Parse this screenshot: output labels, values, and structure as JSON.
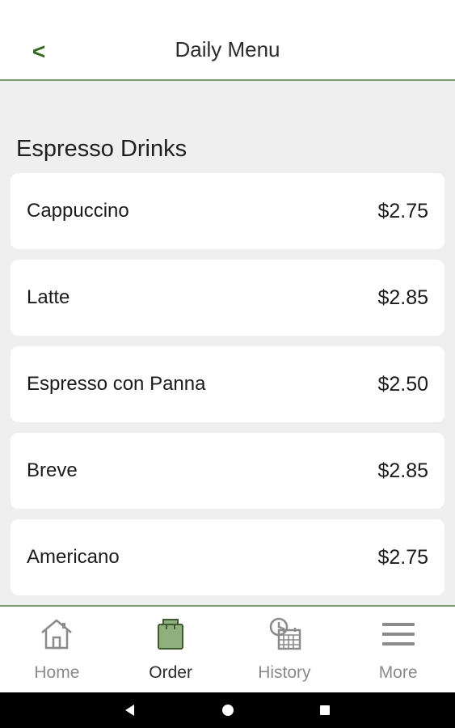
{
  "header": {
    "back_label": "<",
    "title": "Daily Menu"
  },
  "section": {
    "title": "Espresso Drinks"
  },
  "menu_items": [
    {
      "name": "Cappuccino",
      "price": "$2.75"
    },
    {
      "name": "Latte",
      "price": "$2.85"
    },
    {
      "name": "Espresso con Panna",
      "price": "$2.50"
    },
    {
      "name": "Breve",
      "price": "$2.85"
    },
    {
      "name": "Americano",
      "price": "$2.75"
    }
  ],
  "bottom_nav": {
    "items": [
      {
        "label": "Home",
        "icon": "home-icon",
        "active": false
      },
      {
        "label": "Order",
        "icon": "shopping-bag-icon",
        "active": true
      },
      {
        "label": "History",
        "icon": "history-calendar-icon",
        "active": false
      },
      {
        "label": "More",
        "icon": "menu-icon",
        "active": false
      }
    ]
  },
  "system_nav": {
    "buttons": [
      {
        "icon": "back-triangle-icon"
      },
      {
        "icon": "home-circle-icon"
      },
      {
        "icon": "recents-square-icon"
      }
    ]
  },
  "colors": {
    "accent_green": "#2f6a1d",
    "divider_green": "#7f9a72",
    "bag_green": "#8fb07d",
    "background": "#efefef"
  }
}
